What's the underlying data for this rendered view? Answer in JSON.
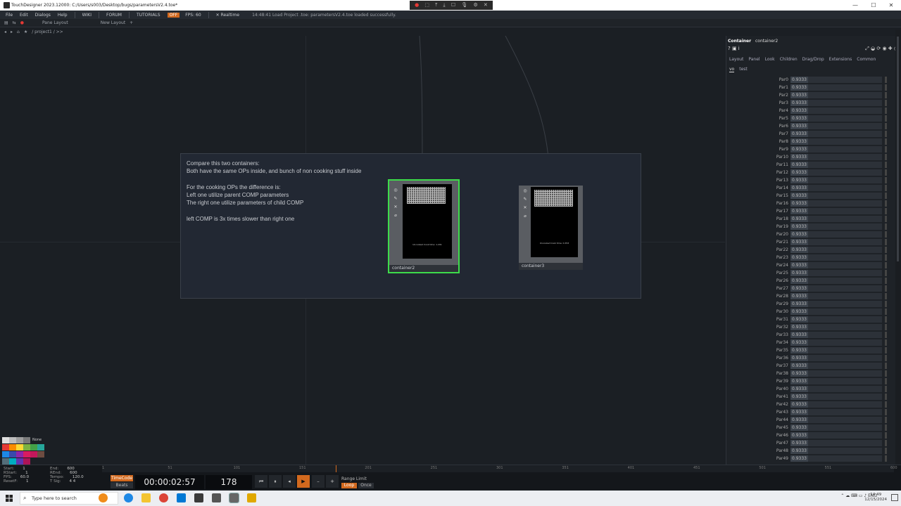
{
  "window": {
    "title": "TouchDesigner 2023.12000: C:/Users/s003/Desktop/bugs/parametersV2.4.toe*",
    "minimize": "—",
    "maximize": "☐",
    "close": "✕"
  },
  "rec_tools": [
    "●",
    "⬚",
    "⤒",
    "⤓",
    "☐",
    "🎙",
    "⚙",
    "✕"
  ],
  "menubar": {
    "items": [
      "File",
      "Edit",
      "Dialogs",
      "Help"
    ],
    "links": [
      "WIKI",
      "FORUM",
      "TUTORIALS"
    ],
    "badge": "OFF",
    "fps": "FPS: 60",
    "realtime": "Realtime",
    "status": "14:48:41 Load Project .toe: parametersV2.4.toe loaded successfully."
  },
  "toolbar": {
    "pane_layout": "Pane Layout",
    "new_layout": "New Layout",
    "add": "+"
  },
  "path": {
    "back": "◂",
    "forward": "▸",
    "home": "⌂",
    "star": "★",
    "path_text": "/ project1 / >>"
  },
  "annotation": {
    "text": "Compare this two containers:\nBoth have the same OPs inside, and bunch of non cooking stuff inside\n\nFor the cooking OPs the difference is:\nLeft one utilize parent COMP parameters\nThe right one utilize parameters of child COMP\n\nleft COMP is 3x times slower than right one"
  },
  "nodes": [
    {
      "name": "container2",
      "caption": "Uncooked Cook time: 1.201",
      "selected": true
    },
    {
      "name": "container3",
      "caption": "Uncooked Cook time: 0.353",
      "selected": false
    }
  ],
  "node_icons": [
    "◎",
    "✎",
    "✕",
    "⌀"
  ],
  "panel": {
    "op_type": "Container",
    "op_name": "container2",
    "left_icons": "? ▣ i",
    "right_icons": "⤢ ◒ ⟳ ◉ ✚ ◎",
    "tabs": [
      "Layout",
      "Panel",
      "Look",
      "Children",
      "Drag/Drop",
      "Extensions",
      "Common"
    ],
    "pages": [
      "vo",
      "test"
    ],
    "params": [
      {
        "name": "Par0",
        "value": "0.9333"
      },
      {
        "name": "Par1",
        "value": "0.9333"
      },
      {
        "name": "Par2",
        "value": "0.9333"
      },
      {
        "name": "Par3",
        "value": "0.9333"
      },
      {
        "name": "Par4",
        "value": "0.9333"
      },
      {
        "name": "Par5",
        "value": "0.9333"
      },
      {
        "name": "Par6",
        "value": "0.9333"
      },
      {
        "name": "Par7",
        "value": "0.9333"
      },
      {
        "name": "Par8",
        "value": "0.9333"
      },
      {
        "name": "Par9",
        "value": "0.9333"
      },
      {
        "name": "Par10",
        "value": "0.9333"
      },
      {
        "name": "Par11",
        "value": "0.9333"
      },
      {
        "name": "Par12",
        "value": "0.9333"
      },
      {
        "name": "Par13",
        "value": "0.9333"
      },
      {
        "name": "Par14",
        "value": "0.9333"
      },
      {
        "name": "Par15",
        "value": "0.9333"
      },
      {
        "name": "Par16",
        "value": "0.9333"
      },
      {
        "name": "Par17",
        "value": "0.9333"
      },
      {
        "name": "Par18",
        "value": "0.9333"
      },
      {
        "name": "Par19",
        "value": "0.9333"
      },
      {
        "name": "Par20",
        "value": "0.9333"
      },
      {
        "name": "Par21",
        "value": "0.9333"
      },
      {
        "name": "Par22",
        "value": "0.9333"
      },
      {
        "name": "Par23",
        "value": "0.9333"
      },
      {
        "name": "Par24",
        "value": "0.9333"
      },
      {
        "name": "Par25",
        "value": "0.9333"
      },
      {
        "name": "Par26",
        "value": "0.9333"
      },
      {
        "name": "Par27",
        "value": "0.9333"
      },
      {
        "name": "Par28",
        "value": "0.9333"
      },
      {
        "name": "Par29",
        "value": "0.9333"
      },
      {
        "name": "Par30",
        "value": "0.9333"
      },
      {
        "name": "Par31",
        "value": "0.9333"
      },
      {
        "name": "Par32",
        "value": "0.9333"
      },
      {
        "name": "Par33",
        "value": "0.9333"
      },
      {
        "name": "Par34",
        "value": "0.9333"
      },
      {
        "name": "Par35",
        "value": "0.9333"
      },
      {
        "name": "Par36",
        "value": "0.9333"
      },
      {
        "name": "Par37",
        "value": "0.9333"
      },
      {
        "name": "Par38",
        "value": "0.9333"
      },
      {
        "name": "Par39",
        "value": "0.9333"
      },
      {
        "name": "Par40",
        "value": "0.9333"
      },
      {
        "name": "Par41",
        "value": "0.9333"
      },
      {
        "name": "Par42",
        "value": "0.9333"
      },
      {
        "name": "Par43",
        "value": "0.9333"
      },
      {
        "name": "Par44",
        "value": "0.9333"
      },
      {
        "name": "Par45",
        "value": "0.9333"
      },
      {
        "name": "Par46",
        "value": "0.9333"
      },
      {
        "name": "Par47",
        "value": "0.9333"
      },
      {
        "name": "Par48",
        "value": "0.9333"
      },
      {
        "name": "Par49",
        "value": "0.9333"
      }
    ]
  },
  "palette": {
    "none_label": "None",
    "colors": [
      "#e0e0e0",
      "#bdbdbd",
      "#9e9e9e",
      "#7a7a7a",
      "#e53935",
      "#fb8c00",
      "#fdd835",
      "#7cb342",
      "#43a047",
      "#26a69a",
      "#1e88e5",
      "#3949ab",
      "#8e24aa",
      "#d81b60",
      "#c2185b",
      "#6d4c41",
      "#546e7a",
      "#00acc1",
      "#5e35b1",
      "#ad1457"
    ]
  },
  "timeline": {
    "ticks": [
      "1",
      "51",
      "101",
      "151",
      "201",
      "251",
      "301",
      "351",
      "401",
      "451",
      "501",
      "551",
      "600"
    ],
    "stats_left": [
      {
        "label": "Start:",
        "value": "1"
      },
      {
        "label": "RStart:",
        "value": "1"
      },
      {
        "label": "FPS:",
        "value": "60.0"
      },
      {
        "label": "ResetF:",
        "value": "1"
      }
    ],
    "stats_right": [
      {
        "label": "End:",
        "value": "600"
      },
      {
        "label": "REnd:",
        "value": "600"
      },
      {
        "label": "Tempo:",
        "value": "120.0"
      },
      {
        "label": "T Sig:",
        "value": "4   4"
      }
    ],
    "timecode_btn": "TimeCode",
    "beats_btn": "Beats",
    "timecode": "00:00:02:57",
    "frame": "178",
    "controls": [
      "⏮",
      "⏸",
      "◂",
      "▶",
      "–",
      "+"
    ],
    "range_limit": "Range Limit",
    "loop": "Loop",
    "once": "Once"
  },
  "taskbar": {
    "search_placeholder": "Type here to search",
    "tray": "⌃  ☁  ⌨  ▭  ♪  ENG",
    "time": "14:49",
    "date": "12/15/2024"
  }
}
